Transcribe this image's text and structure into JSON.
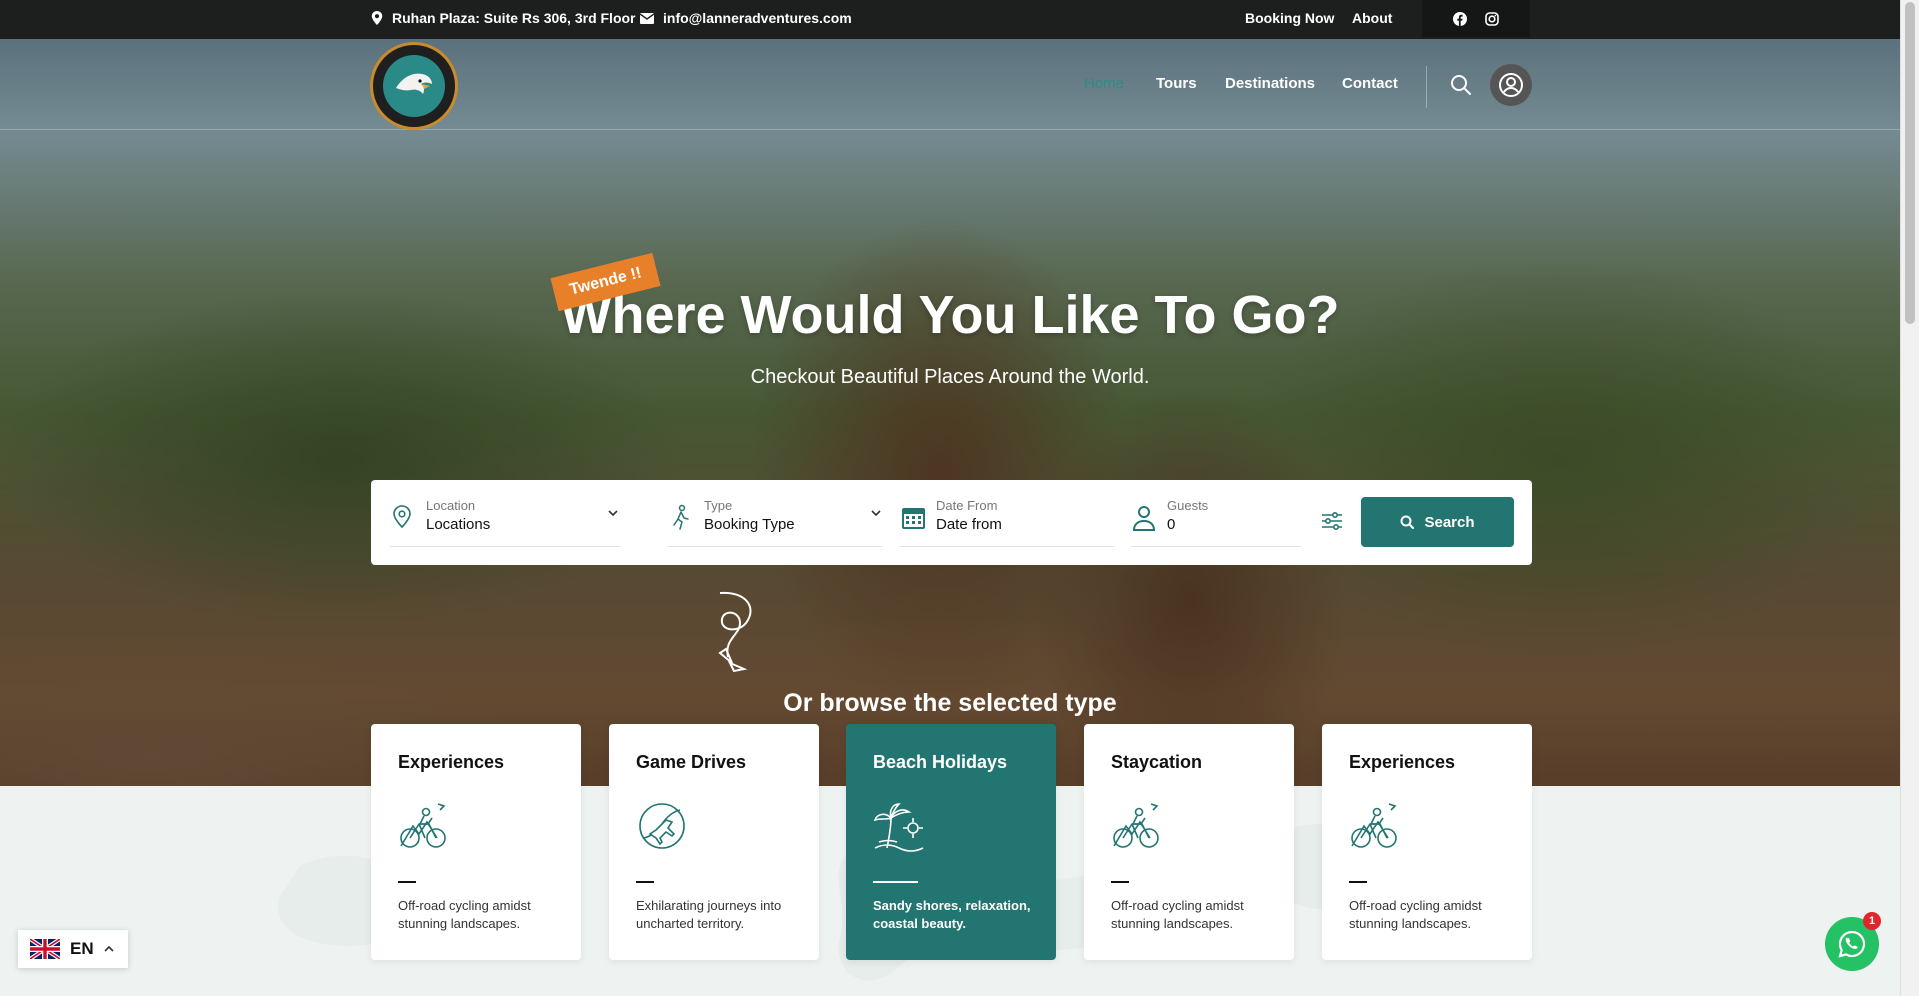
{
  "topbar": {
    "address": "Ruhan Plaza: Suite Rs 306, 3rd Floor",
    "email": "info@lanneradventures.com",
    "links": {
      "booking": "Booking Now",
      "about": "About"
    },
    "social": [
      "facebook-icon",
      "instagram-icon"
    ]
  },
  "nav": {
    "home": "Home",
    "tours": "Tours",
    "destinations": "Destinations",
    "contact": "Contact"
  },
  "hero": {
    "badge": "Twende !!",
    "title": "Where Would You Like To Go?",
    "subtitle": "Checkout Beautiful Places Around the World."
  },
  "search": {
    "location": {
      "label": "Location",
      "value": "Locations"
    },
    "type": {
      "label": "Type",
      "value": "Booking Type"
    },
    "date": {
      "label": "Date From",
      "value": "Date from"
    },
    "guests": {
      "label": "Guests",
      "value": "0"
    },
    "button": "Search"
  },
  "browse": {
    "title": "Or browse the selected type"
  },
  "cards": [
    {
      "title": "Experiences",
      "desc": "Off-road cycling amidst stunning landscapes.",
      "icon": "cycling-icon",
      "active": false
    },
    {
      "title": "Game Drives",
      "desc": "Exhilarating journeys into uncharted territory.",
      "icon": "globe-plane-icon",
      "active": false
    },
    {
      "title": "Beach Holidays",
      "desc": "Sandy shores, relaxation, coastal beauty.",
      "icon": "beach-icon",
      "active": true
    },
    {
      "title": "Staycation",
      "desc": "Off-road cycling amidst stunning landscapes.",
      "icon": "cycling-icon",
      "active": false
    },
    {
      "title": "Experiences",
      "desc": "Off-road cycling amidst stunning landscapes.",
      "icon": "cycling-icon",
      "active": false
    }
  ],
  "language": {
    "code": "EN"
  },
  "whatsapp": {
    "badge": "1"
  },
  "colors": {
    "brand": "#237571",
    "accent": "#e8802a",
    "topbar": "#1d1f1f",
    "whatsapp": "#25c165"
  }
}
